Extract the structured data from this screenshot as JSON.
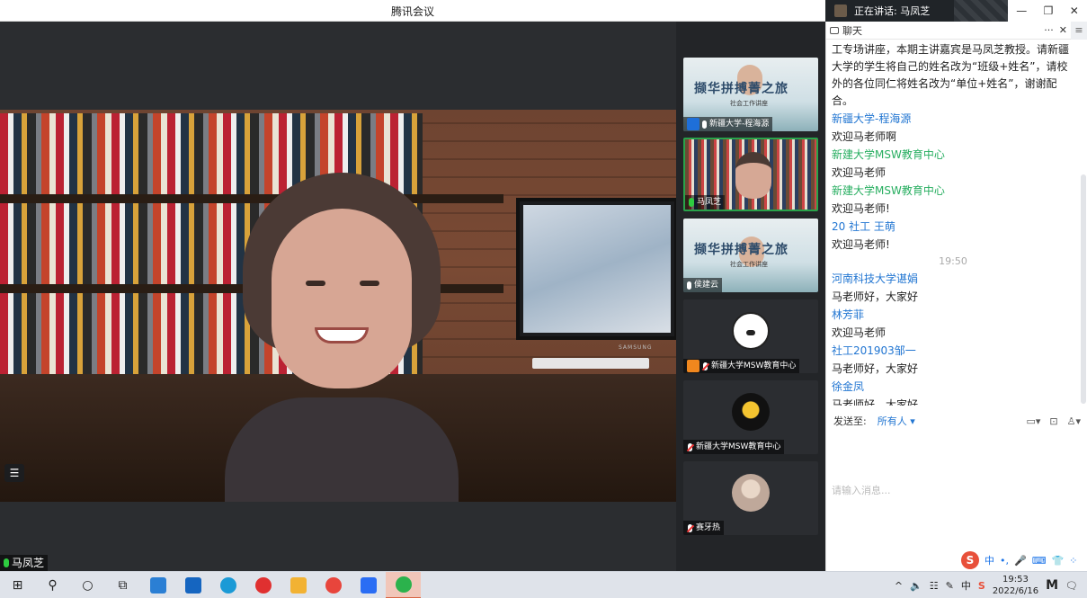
{
  "window": {
    "title": "腾讯会议",
    "speaking_label": "正在讲话: 马凤芝",
    "controls": {
      "minimize": "—",
      "restore": "❐",
      "close": "✕"
    }
  },
  "main_video": {
    "speaker_name": "马凤芝",
    "monitor_brand": "SAMSUNG",
    "list_icon": "☰"
  },
  "gallery": [
    {
      "name": "新疆大学-程海源",
      "type": "banner",
      "banner_text": "撷华拼搏菁之旅",
      "banner_sub": "社会工作讲座",
      "icon": "user-icon",
      "icon_color": "#1e6fd9",
      "mic": "on"
    },
    {
      "name": "马凤芝",
      "type": "bookshelf",
      "mic": "speaking",
      "active": true
    },
    {
      "name": "侯建云",
      "type": "banner",
      "banner_text": "撷华拼搏菁之旅",
      "banner_sub": "社会工作讲座",
      "mic": "on"
    },
    {
      "name": "新疆大学MSW教育中心",
      "type": "avatar-dog",
      "icon": "user-icon",
      "icon_color": "#f0871e",
      "mic": "muted"
    },
    {
      "name": "新疆大学MSW教育中心",
      "type": "avatar-planet",
      "mic": "muted"
    },
    {
      "name": "赛牙热",
      "type": "avatar-photo",
      "mic": "muted"
    }
  ],
  "chat": {
    "header_title": "聊天",
    "header_more": "···",
    "header_close": "✕",
    "side_menu": "≡",
    "intro_text": "工专场讲座，本期主讲嘉宾是马凤芝教授。请新疆大学的学生将自己的姓名改为“班级+姓名”，请校外的各位同仁将姓名改为“单位+姓名”，谢谢配合。",
    "messages_before": [
      {
        "sender": "新疆大学-程海源",
        "color": "blue",
        "text": "欢迎马老师啊"
      },
      {
        "sender": "新建大学MSW教育中心",
        "color": "green",
        "text": "欢迎马老师"
      },
      {
        "sender": "新建大学MSW教育中心",
        "color": "green",
        "text": "欢迎马老师!"
      },
      {
        "sender": "20 社工 王萌",
        "color": "blue",
        "text": "欢迎马老师!"
      }
    ],
    "time_divider": "19:50",
    "messages_after": [
      {
        "sender": "河南科技大学谌娟",
        "color": "blue",
        "text": "马老师好，大家好"
      },
      {
        "sender": "林芳菲",
        "color": "blue",
        "text": "欢迎马老师"
      },
      {
        "sender": "社工201903邹一",
        "color": "blue",
        "text": "马老师好，大家好"
      },
      {
        "sender": "徐金凤",
        "color": "blue",
        "text": "马老师好，大家好"
      }
    ],
    "send_to_label": "发送至:",
    "send_to_value": "所有人 ▾",
    "input_placeholder": "请输入消息...",
    "tools": [
      "▭▾",
      "⊡",
      "♙▾"
    ],
    "ime": {
      "logo": "S",
      "items": [
        "中",
        "•,",
        "🎤",
        "⌨",
        "👕",
        "⁘"
      ]
    }
  },
  "taskbar": {
    "apps": [
      {
        "name": "start-icon",
        "glyph": "⊞"
      },
      {
        "name": "search-icon",
        "glyph": "⚲"
      },
      {
        "name": "cortana-icon",
        "glyph": "○"
      },
      {
        "name": "task-view-icon",
        "glyph": "⧉"
      },
      {
        "name": "store-icon",
        "color": "#2b7fd4"
      },
      {
        "name": "mail-icon",
        "color": "#1565c0"
      },
      {
        "name": "edge-icon",
        "color": "#1b9ad6"
      },
      {
        "name": "netease-music-icon",
        "color": "#e03030"
      },
      {
        "name": "file-explorer-icon",
        "color": "#f2b233"
      },
      {
        "name": "chrome-icon",
        "color": "#e8453c"
      },
      {
        "name": "tencent-meeting-icon",
        "color": "#2a6df4"
      },
      {
        "name": "wechat-icon",
        "color": "#2bb24c",
        "active": true
      }
    ],
    "tray": {
      "chevron": "^",
      "volume": "🔈",
      "network": "☷",
      "pen": "✎",
      "ime": "中",
      "sogou": "S"
    },
    "time": "19:53",
    "date": "2022/6/16",
    "notification": "🗨"
  }
}
